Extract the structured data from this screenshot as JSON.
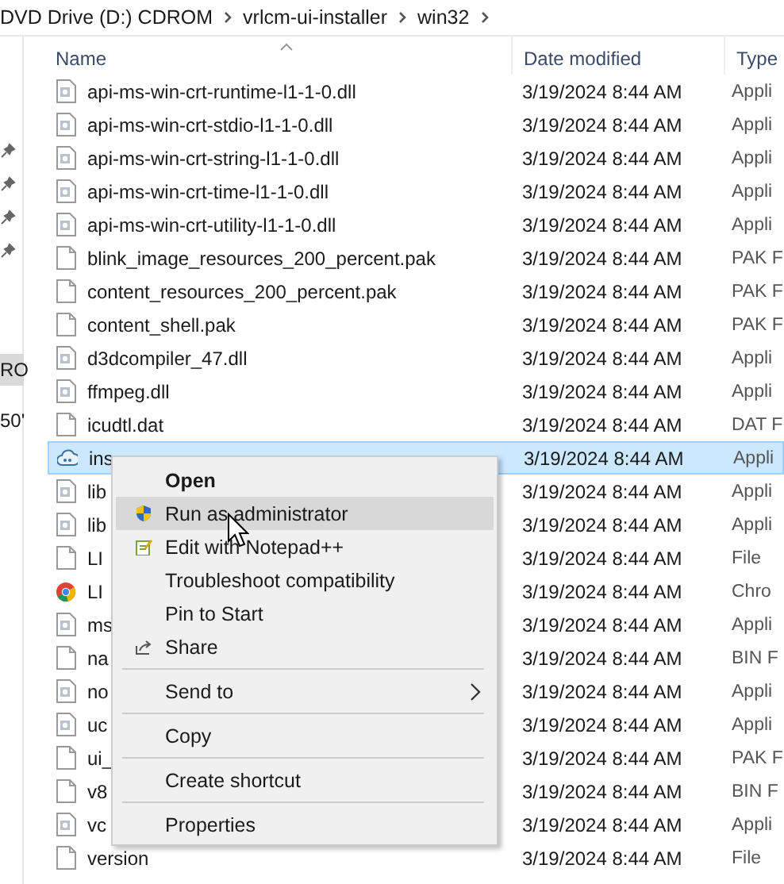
{
  "breadcrumb": [
    "DVD Drive (D:) CDROM",
    "vrlcm-ui-installer",
    "win32"
  ],
  "sidebar": {
    "items": [
      {
        "pinned": true
      },
      {
        "pinned": true
      },
      {
        "pinned": true
      },
      {
        "pinned": true
      },
      {
        "label": "RO",
        "selected": true
      },
      {
        "label": "50'",
        "selected": false
      }
    ]
  },
  "table": {
    "columns": [
      {
        "label": "Name",
        "sorted": true
      },
      {
        "label": "Date modified",
        "sorted": false
      },
      {
        "label": "Type",
        "sorted": false
      }
    ],
    "rows": [
      {
        "kind": "dll",
        "name": "api-ms-win-crt-runtime-l1-1-0.dll",
        "date": "3/19/2024 8:44 AM",
        "type": "Appli",
        "selected": false
      },
      {
        "kind": "dll",
        "name": "api-ms-win-crt-stdio-l1-1-0.dll",
        "date": "3/19/2024 8:44 AM",
        "type": "Appli",
        "selected": false
      },
      {
        "kind": "dll",
        "name": "api-ms-win-crt-string-l1-1-0.dll",
        "date": "3/19/2024 8:44 AM",
        "type": "Appli",
        "selected": false
      },
      {
        "kind": "dll",
        "name": "api-ms-win-crt-time-l1-1-0.dll",
        "date": "3/19/2024 8:44 AM",
        "type": "Appli",
        "selected": false
      },
      {
        "kind": "dll",
        "name": "api-ms-win-crt-utility-l1-1-0.dll",
        "date": "3/19/2024 8:44 AM",
        "type": "Appli",
        "selected": false
      },
      {
        "kind": "file",
        "name": "blink_image_resources_200_percent.pak",
        "date": "3/19/2024 8:44 AM",
        "type": "PAK F",
        "selected": false
      },
      {
        "kind": "file",
        "name": "content_resources_200_percent.pak",
        "date": "3/19/2024 8:44 AM",
        "type": "PAK F",
        "selected": false
      },
      {
        "kind": "file",
        "name": "content_shell.pak",
        "date": "3/19/2024 8:44 AM",
        "type": "PAK F",
        "selected": false
      },
      {
        "kind": "dll",
        "name": "d3dcompiler_47.dll",
        "date": "3/19/2024 8:44 AM",
        "type": "Appli",
        "selected": false
      },
      {
        "kind": "dll",
        "name": "ffmpeg.dll",
        "date": "3/19/2024 8:44 AM",
        "type": "Appli",
        "selected": false
      },
      {
        "kind": "file",
        "name": "icudtl.dat",
        "date": "3/19/2024 8:44 AM",
        "type": "DAT F",
        "selected": false
      },
      {
        "kind": "cloud",
        "name": "ins",
        "date": "3/19/2024 8:44 AM",
        "type": "Appli",
        "selected": true
      },
      {
        "kind": "dll",
        "name": "lib",
        "date": "3/19/2024 8:44 AM",
        "type": "Appli",
        "selected": false
      },
      {
        "kind": "dll",
        "name": "lib",
        "date": "3/19/2024 8:44 AM",
        "type": "Appli",
        "selected": false
      },
      {
        "kind": "file",
        "name": "LI",
        "date": "3/19/2024 8:44 AM",
        "type": "File",
        "selected": false
      },
      {
        "kind": "chrome",
        "name": "LI",
        "date": "3/19/2024 8:44 AM",
        "type": "Chro",
        "selected": false
      },
      {
        "kind": "dll",
        "name": "ms",
        "date": "3/19/2024 8:44 AM",
        "type": "Appli",
        "selected": false
      },
      {
        "kind": "file",
        "name": "na",
        "date": "3/19/2024 8:44 AM",
        "type": "BIN F",
        "selected": false
      },
      {
        "kind": "dll",
        "name": "no",
        "date": "3/19/2024 8:44 AM",
        "type": "Appli",
        "selected": false
      },
      {
        "kind": "dll",
        "name": "uc",
        "date": "3/19/2024 8:44 AM",
        "type": "Appli",
        "selected": false
      },
      {
        "kind": "file",
        "name": "ui_",
        "date": "3/19/2024 8:44 AM",
        "type": "PAK F",
        "selected": false
      },
      {
        "kind": "file",
        "name": "v8",
        "date": "3/19/2024 8:44 AM",
        "type": "BIN F",
        "selected": false
      },
      {
        "kind": "dll",
        "name": "vc",
        "date": "3/19/2024 8:44 AM",
        "type": "Appli",
        "selected": false
      },
      {
        "kind": "file",
        "name": "version",
        "date": "3/19/2024 8:44 AM",
        "type": "File",
        "selected": false
      }
    ]
  },
  "context_menu": {
    "items": [
      {
        "label": "Open",
        "default": true,
        "selected": false
      },
      {
        "label": "Run as administrator",
        "kind": "shield",
        "selected": true
      },
      {
        "label": "Edit with Notepad++",
        "kind": "notepad",
        "selected": false
      },
      {
        "label": "Troubleshoot compatibility",
        "selected": false
      },
      {
        "label": "Pin to Start",
        "selected": false
      },
      {
        "label": "Share",
        "kind": "share",
        "selected": false
      },
      {
        "label": "Send to",
        "submenu": true,
        "separator_before": true,
        "selected": false
      },
      {
        "label": "Copy",
        "separator_before": true,
        "selected": false
      },
      {
        "label": "Create shortcut",
        "separator_before": true,
        "selected": false
      },
      {
        "label": "Properties",
        "separator_before": true,
        "selected": false
      }
    ]
  }
}
